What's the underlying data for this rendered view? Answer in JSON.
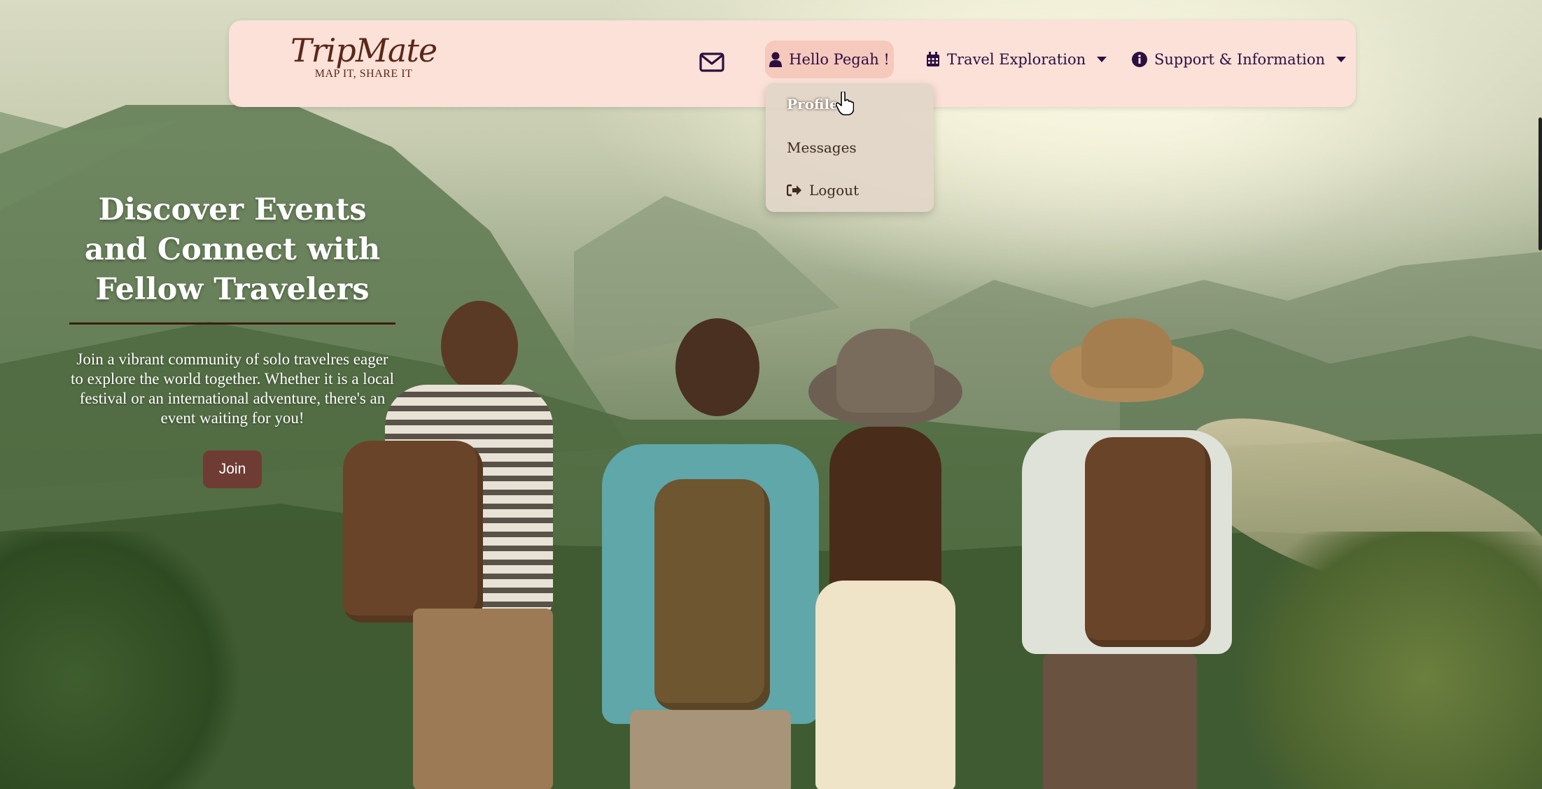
{
  "brand": {
    "name": "TripMate",
    "tagline": "MAP IT, SHARE IT"
  },
  "nav": {
    "mail_icon": "envelope-icon",
    "user_greeting": "Hello Pegah !",
    "user_icon": "user-icon",
    "travel_exploration": "Travel Exploration",
    "travel_icon": "calendar-icon",
    "support_information": "Support & Information",
    "support_icon": "info-circle-icon"
  },
  "user_menu": {
    "items": [
      {
        "label": "Profile",
        "active": true
      },
      {
        "label": "Messages",
        "active": false
      },
      {
        "label": "Logout",
        "icon": "logout-icon",
        "active": false
      }
    ]
  },
  "hero": {
    "title": "Discover Events and Connect with Fellow Travelers",
    "subtitle": "Join a vibrant community of solo travelres eager to explore the world together. Whether it is a local festival or an international adventure, there's an event waiting for you!",
    "cta": "Join"
  },
  "colors": {
    "navbar_bg": "#fbe1d8",
    "user_pill_bg": "#f6c9bd",
    "nav_text": "#2b0f40",
    "brand": "#5a2718",
    "dropdown_bg": "#e2d6c8",
    "join_button": "#6e3c33"
  }
}
